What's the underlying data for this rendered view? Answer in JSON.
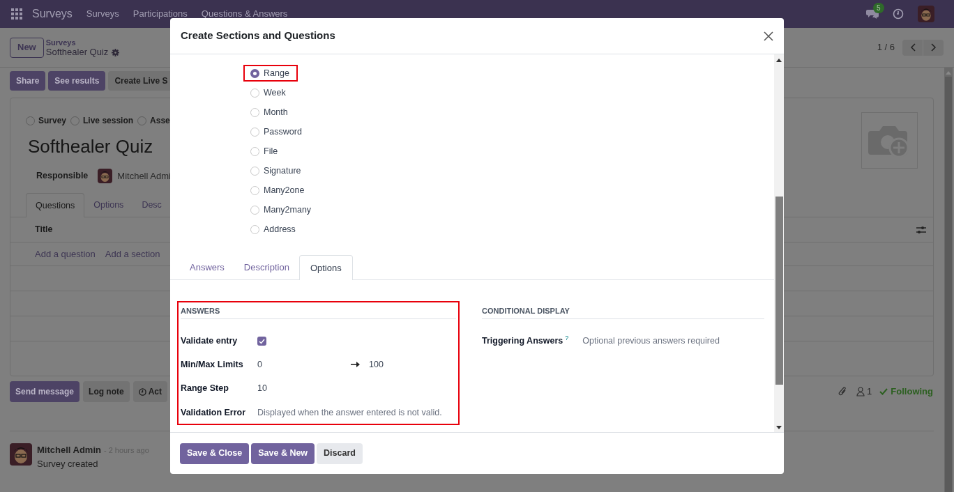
{
  "navbar": {
    "app": "Surveys",
    "menu": [
      "Surveys",
      "Participations",
      "Questions & Answers"
    ],
    "message_count": "5"
  },
  "control_panel": {
    "new_button": "New",
    "breadcrumb_parent": "Surveys",
    "record": "Softhealer Quiz",
    "pager": "1 / 6"
  },
  "action_buttons": [
    {
      "label": "Share",
      "kind": "primary"
    },
    {
      "label": "See results",
      "kind": "primary"
    },
    {
      "label": "Create Live S",
      "kind": "secondary"
    }
  ],
  "survey_types": [
    {
      "label": "Survey",
      "selected": false
    },
    {
      "label": "Live session",
      "selected": false
    },
    {
      "label": "Asse",
      "selected": false
    }
  ],
  "title": "Softhealer Quiz",
  "responsible": {
    "label": "Responsible",
    "value": "Mitchell Admi"
  },
  "tabs": [
    {
      "label": "Questions",
      "selected": true
    },
    {
      "label": "Options",
      "selected": false
    },
    {
      "label": "Desc",
      "selected": false
    }
  ],
  "list": {
    "column": "Title",
    "add_question": "Add a question",
    "add_section": "Add a section"
  },
  "chatter": {
    "buttons": [
      {
        "label": "Send message",
        "kind": "primary"
      },
      {
        "label": "Log note",
        "kind": "secondary"
      },
      {
        "label": "Act",
        "kind": "activity"
      }
    ],
    "followers": "1",
    "following": "Following",
    "message": {
      "author": "Mitchell Admin",
      "time": "- 2 hours ago",
      "body": "Survey created"
    }
  },
  "dialog": {
    "title": "Create Sections and Questions",
    "question_types": [
      {
        "label": "Range",
        "selected": true,
        "highlighted": true
      },
      {
        "label": "Week",
        "selected": false,
        "highlighted": false
      },
      {
        "label": "Month",
        "selected": false,
        "highlighted": false
      },
      {
        "label": "Password",
        "selected": false,
        "highlighted": false
      },
      {
        "label": "File",
        "selected": false,
        "highlighted": false
      },
      {
        "label": "Signature",
        "selected": false,
        "highlighted": false
      },
      {
        "label": "Many2one",
        "selected": false,
        "highlighted": false
      },
      {
        "label": "Many2many",
        "selected": false,
        "highlighted": false
      },
      {
        "label": "Address",
        "selected": false,
        "highlighted": false
      }
    ],
    "tabs": [
      {
        "label": "Answers",
        "selected": false
      },
      {
        "label": "Description",
        "selected": false
      },
      {
        "label": "Options",
        "selected": true
      }
    ],
    "answers": {
      "title": "ANSWERS",
      "highlighted": true,
      "validate_label": "Validate entry",
      "validate_checked": true,
      "limits_label": "Min/Max Limits",
      "min": "0",
      "max": "100",
      "step_label": "Range Step",
      "step": "10",
      "error_label": "Validation Error",
      "error_placeholder": "Displayed when the answer entered is not valid."
    },
    "conditional": {
      "title": "CONDITIONAL DISPLAY",
      "label": "Triggering Answers",
      "help": "?",
      "placeholder": "Optional previous answers required"
    },
    "buttons": [
      {
        "label": "Save & Close",
        "kind": "primary"
      },
      {
        "label": "Save & New",
        "kind": "primary"
      },
      {
        "label": "Discard",
        "kind": "secondary"
      }
    ]
  }
}
